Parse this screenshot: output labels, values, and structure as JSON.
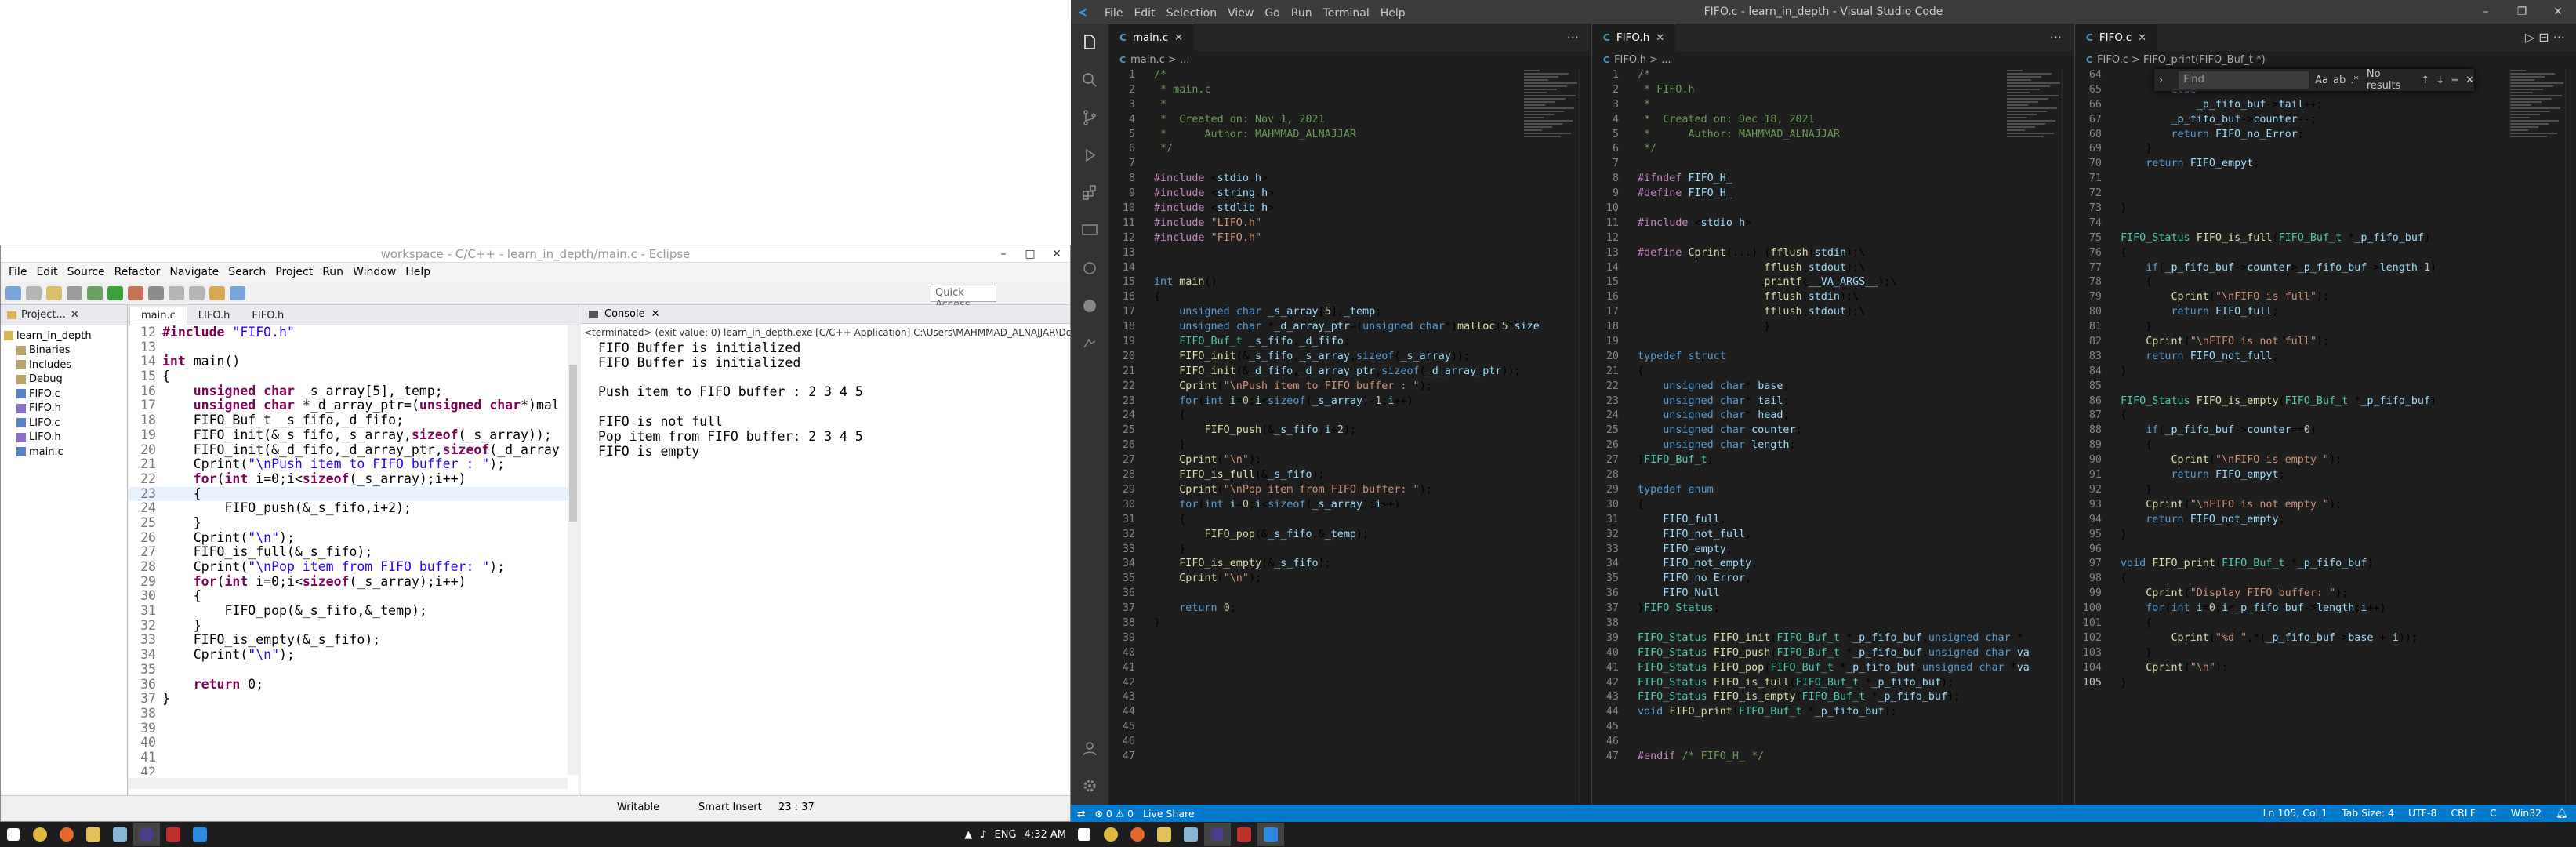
{
  "eclipse": {
    "title": "workspace - C/C++ - learn_in_depth/main.c - Eclipse",
    "menu": [
      "File",
      "Edit",
      "Source",
      "Refactor",
      "Navigate",
      "Search",
      "Project",
      "Run",
      "Window",
      "Help"
    ],
    "quick_access": "Quick Access",
    "project_tab": "Project...",
    "tree": [
      {
        "label": "learn_in_depth",
        "level": 0
      },
      {
        "label": "Binaries",
        "level": 1
      },
      {
        "label": "Includes",
        "level": 1
      },
      {
        "label": "Debug",
        "level": 1
      },
      {
        "label": "FIFO.c",
        "level": 1
      },
      {
        "label": "FIFO.h",
        "level": 1
      },
      {
        "label": "LIFO.c",
        "level": 1
      },
      {
        "label": "LIFO.h",
        "level": 1
      },
      {
        "label": "main.c",
        "level": 1
      }
    ],
    "editor_tabs": [
      "main.c",
      "LIFO.h",
      "FIFO.h"
    ],
    "code_lines": [
      {
        "n": "12",
        "t": "#include \"FIFO.h\""
      },
      {
        "n": "13",
        "t": ""
      },
      {
        "n": "14",
        "t": "int main()"
      },
      {
        "n": "15",
        "t": "{"
      },
      {
        "n": "16",
        "t": "    unsigned char _s_array[5],_temp;"
      },
      {
        "n": "17",
        "t": "    unsigned char *_d_array_ptr=(unsigned char*)mal"
      },
      {
        "n": "18",
        "t": "    FIFO_Buf_t _s_fifo,_d_fifo;"
      },
      {
        "n": "19",
        "t": "    FIFO_init(&_s_fifo,_s_array,sizeof(_s_array));"
      },
      {
        "n": "20",
        "t": "    FIFO_init(&_d_fifo,_d_array_ptr,sizeof(_d_array"
      },
      {
        "n": "21",
        "t": "    Cprint(\"\\nPush item to FIFO buffer : \");"
      },
      {
        "n": "22",
        "t": "    for(int i=0;i<sizeof(_s_array);i++)"
      },
      {
        "n": "23",
        "t": "    {"
      },
      {
        "n": "24",
        "t": "        FIFO_push(&_s_fifo,i+2);"
      },
      {
        "n": "25",
        "t": "    }"
      },
      {
        "n": "26",
        "t": "    Cprint(\"\\n\");"
      },
      {
        "n": "27",
        "t": "    FIFO_is_full(&_s_fifo);"
      },
      {
        "n": "28",
        "t": "    Cprint(\"\\nPop item from FIFO buffer: \");"
      },
      {
        "n": "29",
        "t": "    for(int i=0;i<sizeof(_s_array);i++)"
      },
      {
        "n": "30",
        "t": "    {"
      },
      {
        "n": "31",
        "t": "        FIFO_pop(&_s_fifo,&_temp);"
      },
      {
        "n": "32",
        "t": "    }"
      },
      {
        "n": "33",
        "t": "    FIFO_is_empty(&_s_fifo);"
      },
      {
        "n": "34",
        "t": "    Cprint(\"\\n\");"
      },
      {
        "n": "35",
        "t": ""
      },
      {
        "n": "36",
        "t": "    return 0;"
      },
      {
        "n": "37",
        "t": "}"
      },
      {
        "n": "38",
        "t": ""
      },
      {
        "n": "39",
        "t": ""
      },
      {
        "n": "40",
        "t": ""
      },
      {
        "n": "41",
        "t": ""
      },
      {
        "n": "42",
        "t": ""
      }
    ],
    "console_tab": "Console",
    "console_terminated": "<terminated> (exit value: 0) learn_in_depth.exe [C/C++ Application] C:\\Users\\MAHMMAD_ALNAJJAR\\Doc",
    "console_output": "FIFO Buffer is initialized\nFIFO Buffer is initialized\n\nPush item to FIFO buffer : 2 3 4 5\n\nFIFO is not full\nPop item from FIFO buffer: 2 3 4 5\nFIFO is empty",
    "status": {
      "writable": "Writable",
      "insert": "Smart Insert",
      "pos": "23 : 37"
    }
  },
  "taskbar_left": {
    "lang": "ENG",
    "time": "4:32 AM"
  },
  "vscode": {
    "title": "FIFO.c - learn_in_depth - Visual Studio Code",
    "menu": [
      "File",
      "Edit",
      "Selection",
      "View",
      "Go",
      "Run",
      "Terminal",
      "Help"
    ],
    "panes": [
      {
        "tab": "main.c",
        "bread": "main.c > ...",
        "start": 1,
        "lines": [
          "/*",
          " * main.c",
          " *",
          " *  Created on: Nov 1, 2021",
          " *      Author: MAHMMAD_ALNAJJAR",
          " */",
          "",
          "#include <stdio.h>",
          "#include <string.h>",
          "#include <stdlib.h>",
          "#include \"LIFO.h\"",
          "#include \"FIFO.h\"",
          "",
          "",
          "int main()",
          "{",
          "    unsigned char _s_array[5],_temp;",
          "    unsigned char *_d_array_ptr=(unsigned char*)malloc(5*size",
          "    FIFO_Buf_t _s_fifo,_d_fifo;",
          "    FIFO_init(&_s_fifo,_s_array,sizeof(_s_array));",
          "    FIFO_init(&_d_fifo,_d_array_ptr,sizeof(_d_array_ptr));",
          "    Cprint(\"\\nPush item to FIFO buffer : \");",
          "    for(int i=0;i<sizeof(_s_array)-1;i++)",
          "    {",
          "        FIFO_push(&_s_fifo,i+2);",
          "    }",
          "    Cprint(\"\\n\");",
          "    FIFO_is_full(&_s_fifo);",
          "    Cprint(\"\\nPop item from FIFO buffer: \");",
          "    for(int i=0;i<sizeof(_s_array);i++)",
          "    {",
          "        FIFO_pop(&_s_fifo,&_temp);",
          "    }",
          "    FIFO_is_empty(&_s_fifo);",
          "    Cprint(\"\\n\");",
          "",
          "    return 0;",
          "}",
          "",
          "",
          "",
          "",
          "",
          "",
          "",
          "",
          ""
        ]
      },
      {
        "tab": "FIFO.h",
        "bread": "FIFO.h > ...",
        "start": 1,
        "lines": [
          "/*",
          " * FIFO.h",
          " *",
          " *  Created on: Dec 18, 2021",
          " *      Author: MAHMMAD_ALNAJJAR",
          " */",
          "",
          "#ifndef FIFO_H_",
          "#define FIFO_H_",
          "",
          "#include <stdio.h>",
          "",
          "#define Cprint(...) {fflush(stdin);\\",
          "                    fflush(stdout);\\",
          "                    printf(__VA_ARGS__);\\",
          "                    fflush(stdin);\\",
          "                    fflush(stdout);\\",
          "                    }",
          "",
          "typedef struct",
          "{",
          "    unsigned char* base;",
          "    unsigned char* tail;",
          "    unsigned char* head;",
          "    unsigned char counter;",
          "    unsigned char length;",
          "}FIFO_Buf_t;",
          "",
          "typedef enum",
          "{",
          "    FIFO_full,",
          "    FIFO_not_full,",
          "    FIFO_empty,",
          "    FIFO_not_empty,",
          "    FIFO_no_Error,",
          "    FIFO_Null",
          "}FIFO_Status;",
          "",
          "FIFO_Status FIFO_init(FIFO_Buf_t *_p_fifo_buf,unsigned char *",
          "FIFO_Status FIFO_push(FIFO_Buf_t *_p_fifo_buf,unsigned char va",
          "FIFO_Status FIFO_pop(FIFO_Buf_t *_p_fifo_buf,unsigned char *va",
          "FIFO_Status FIFO_is_full(FIFO_Buf_t *_p_fifo_buf);",
          "FIFO_Status FIFO_is_empty(FIFO_Buf_t *_p_fifo_buf);",
          "void FIFO_print(FIFO_Buf_t *_p_fifo_buf);",
          "",
          "",
          "#endif /* FIFO_H_ */"
        ]
      },
      {
        "tab": "FIFO.c",
        "bread": "FIFO.c > FIFO_print(FIFO_Buf_t *)",
        "start": 64,
        "lines": [
          "            _p_fifo_buf->tail=_p_fifo_buf->base;",
          "        else",
          "            _p_fifo_buf->tail++;",
          "        _p_fifo_buf->counter--;",
          "        return FIFO_no_Error;",
          "    }",
          "    return FIFO_empyt;",
          "",
          "",
          "}",
          "",
          "FIFO_Status FIFO_is_full(FIFO_Buf_t *_p_fifo_buf)",
          "{",
          "    if(_p_fifo_buf->counter>_p_fifo_buf->length-1)",
          "    {",
          "        Cprint(\"\\nFIFO is full\");",
          "        return FIFO_full;",
          "    }",
          "    Cprint(\"\\nFIFO is not full\");",
          "    return FIFO_not_full;",
          "}",
          "",
          "FIFO_Status FIFO_is_empty(FIFO_Buf_t *_p_fifo_buf)",
          "{",
          "    if(_p_fifo_buf->counter==0)",
          "    {",
          "        Cprint(\"\\nFIFO is empty \");",
          "        return FIFO_empyt;",
          "    }",
          "    Cprint(\"\\nFIFO is not empty \");",
          "    return FIFO_not_empty;",
          "}",
          "",
          "void FIFO_print(FIFO_Buf_t *_p_fifo_buf)",
          "{",
          "    Cprint(\"Display FIFO buffer: \");",
          "    for(int i=0;i<_p_fifo_buf->length;i++)",
          "    {",
          "        Cprint(\"%d \",*(_p_fifo_buf->base + i));",
          "    }",
          "    Cprint(\"\\n\");",
          "}"
        ]
      }
    ],
    "find": {
      "placeholder": "Find",
      "result": "No results"
    },
    "status_left": [
      "⊗ 0 ⚠ 0",
      "Live Share"
    ],
    "status_right": [
      "Ln 105, Col 1",
      "Tab Size: 4",
      "UTF-8",
      "CRLF",
      "C",
      "Win32"
    ]
  }
}
